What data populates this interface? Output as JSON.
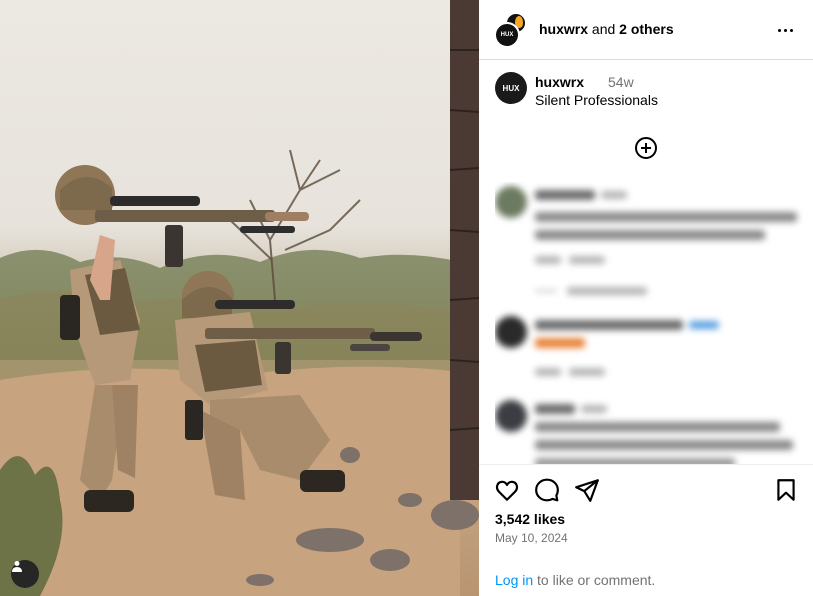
{
  "post": {
    "author": "huxwrx",
    "and_text": "and",
    "others": "2 others",
    "avatar_text": "HUX",
    "caption_user": "huxwrx",
    "caption_age": "54w",
    "caption": "Silent Professionals",
    "likes": "3,542 likes",
    "date": "May 10, 2024"
  },
  "footer": {
    "login_link": "Log in",
    "login_rest": " to like or comment."
  },
  "icons": {
    "more": "more-horizontal-icon",
    "add": "plus-circle-icon",
    "like": "heart-icon",
    "comment": "speech-bubble-icon",
    "share": "paper-plane-icon",
    "save": "bookmark-icon",
    "tag": "user-tag-icon"
  },
  "colors": {
    "link": "#0095f6",
    "muted": "#737373",
    "border": "#dbdbdb"
  }
}
